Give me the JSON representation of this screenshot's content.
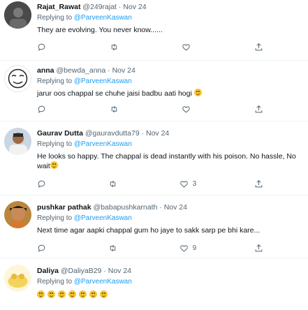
{
  "tweets": [
    {
      "name": "Rajat_Rawat",
      "handle": "@249rajat",
      "sep": "·",
      "date": "Nov 24",
      "replying_prefix": "Replying to",
      "mention": "@ParveenKaswan",
      "text": "They are evolving. You never know......",
      "counts": {
        "reply": "",
        "retweet": "",
        "like": "",
        "share": ""
      }
    },
    {
      "name": "anna",
      "handle": "@bewda_anna",
      "sep": "·",
      "date": "Nov 24",
      "replying_prefix": "Replying to",
      "mention": "@ParveenKaswan",
      "text": "jarur oos chappal se chuhe jaisi badbu aati hogi",
      "emojis": [
        "rofl-emoji"
      ],
      "counts": {
        "reply": "",
        "retweet": "",
        "like": "",
        "share": ""
      }
    },
    {
      "name": "Gaurav Dutta",
      "handle": "@gauravdutta79",
      "sep": "·",
      "date": "Nov 24",
      "replying_prefix": "Replying to",
      "mention": "@ParveenKaswan",
      "text": "He looks so happy. The chappal is dead instantly with his poison. No hassle, No wait",
      "emojis": [
        "smile-emoji"
      ],
      "counts": {
        "reply": "",
        "retweet": "",
        "like": "3",
        "share": ""
      }
    },
    {
      "name": "pushkar pathak",
      "handle": "@babapushkarnath",
      "sep": "·",
      "date": "Nov 24",
      "replying_prefix": "Replying to",
      "mention": "@ParveenKaswan",
      "text": "Next time agar aapki chappal gum ho jaye to sakk sarp pe bhi kare...",
      "counts": {
        "reply": "",
        "retweet": "",
        "like": "9",
        "share": ""
      }
    },
    {
      "name": "Daliya",
      "handle": "@DaliyaB29",
      "sep": "·",
      "date": "Nov 24",
      "replying_prefix": "Replying to",
      "mention": "@ParveenKaswan",
      "text": "",
      "emojis": [
        "grinning-emoji",
        "grinning-emoji",
        "grinning-emoji",
        "grinning-emoji",
        "grinning-emoji",
        "grinning-emoji",
        "grinning-emoji"
      ],
      "counts": {
        "reply": "",
        "retweet": "",
        "like": "",
        "share": ""
      }
    }
  ],
  "colors": {
    "accent": "#1d9bf0",
    "muted": "#536471",
    "text": "#0f1419",
    "border": "#eff3f4"
  }
}
